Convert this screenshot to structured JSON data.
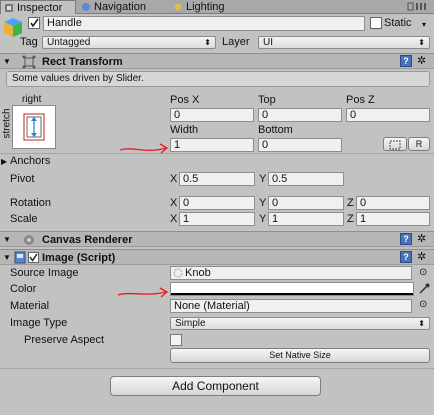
{
  "tabs": [
    {
      "label": "Inspector",
      "icon": "inspector-icon",
      "active": true
    },
    {
      "label": "Navigation",
      "icon": "navigation-icon",
      "active": false
    },
    {
      "label": "Lighting",
      "icon": "lighting-icon",
      "active": false
    }
  ],
  "object": {
    "name": "Handle",
    "active": true,
    "static_label": "Static",
    "tag_label": "Tag",
    "tag_value": "Untagged",
    "layer_label": "Layer",
    "layer_value": "UI"
  },
  "rect_transform": {
    "title": "Rect Transform",
    "info": "Some values driven by Slider.",
    "anchor_preset_top": "right",
    "anchor_preset_side": "stretch",
    "headers": [
      "Pos X",
      "Top",
      "Pos Z"
    ],
    "values_row1": [
      "0",
      "0",
      "0"
    ],
    "headers2": [
      "Width",
      "Bottom"
    ],
    "values_row2": [
      "1",
      "0"
    ],
    "blueprint_button": "",
    "raw_button": "R",
    "anchors_label": "Anchors",
    "pivot_label": "Pivot",
    "pivot": {
      "x_label": "X",
      "x": "0.5",
      "y_label": "Y",
      "y": "0.5"
    },
    "rotation_label": "Rotation",
    "rotation": {
      "x_label": "X",
      "x": "0",
      "y_label": "Y",
      "y": "0",
      "z_label": "Z",
      "z": "0"
    },
    "scale_label": "Scale",
    "scale": {
      "x_label": "X",
      "x": "1",
      "y_label": "Y",
      "y": "1",
      "z_label": "Z",
      "z": "1"
    }
  },
  "canvas_renderer": {
    "title": "Canvas Renderer"
  },
  "image": {
    "title": "Image (Script)",
    "enabled": true,
    "source_image_label": "Source Image",
    "source_image_value": "Knob",
    "color_label": "Color",
    "color_value": "#ffffff",
    "material_label": "Material",
    "material_value": "None (Material)",
    "image_type_label": "Image Type",
    "image_type_value": "Simple",
    "preserve_aspect_label": "Preserve Aspect",
    "preserve_aspect": false,
    "set_native_size": "Set Native Size"
  },
  "add_component": "Add Component",
  "colors": {
    "annotation": "#e02020",
    "panel": "#c2c2c2",
    "help_icon": "#4a72b8"
  }
}
